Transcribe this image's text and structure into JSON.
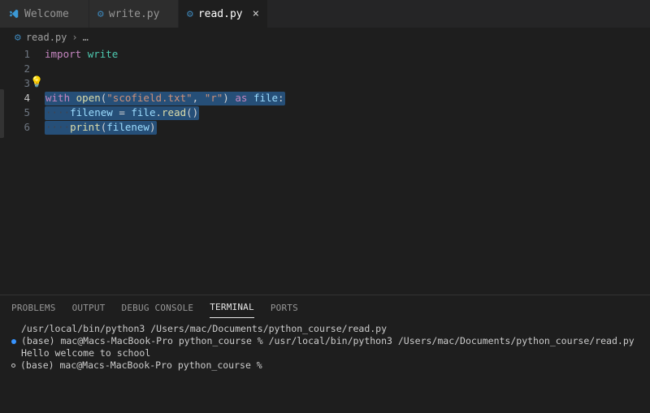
{
  "tabs": [
    {
      "label": "Welcome",
      "icon": "vscode",
      "active": false,
      "close": false
    },
    {
      "label": "write.py",
      "icon": "python",
      "active": false,
      "close": false
    },
    {
      "label": "read.py",
      "icon": "python",
      "active": true,
      "close": true
    }
  ],
  "breadcrumb": {
    "file_icon": "python",
    "file": "read.py",
    "chevron": "›",
    "tail": "…"
  },
  "editor": {
    "lightbulb": "💡",
    "lines": [
      {
        "n": "1",
        "sel": false,
        "tokens": [
          [
            "kw",
            "import"
          ],
          [
            "plain",
            " "
          ],
          [
            "mod",
            "write"
          ]
        ]
      },
      {
        "n": "2",
        "sel": false,
        "tokens": []
      },
      {
        "n": "3",
        "sel": false,
        "tokens": []
      },
      {
        "n": "4",
        "sel": true,
        "active": true,
        "tokens": [
          [
            "kw",
            "with"
          ],
          [
            "plain",
            " "
          ],
          [
            "fn",
            "open"
          ],
          [
            "plain",
            "("
          ],
          [
            "str",
            "\"scofield.txt\""
          ],
          [
            "plain",
            ", "
          ],
          [
            "str",
            "\"r\""
          ],
          [
            "plain",
            ") "
          ],
          [
            "kw",
            "as"
          ],
          [
            "plain",
            " "
          ],
          [
            "var",
            "file"
          ],
          [
            "plain",
            ":"
          ]
        ]
      },
      {
        "n": "5",
        "sel": true,
        "indent": "····",
        "tokens": [
          [
            "var",
            "filenew"
          ],
          [
            "plain",
            " = "
          ],
          [
            "var",
            "file"
          ],
          [
            "plain",
            "."
          ],
          [
            "fn",
            "read"
          ],
          [
            "plain",
            "()"
          ]
        ]
      },
      {
        "n": "6",
        "sel": true,
        "indent": "····",
        "tokens": [
          [
            "fn",
            "print"
          ],
          [
            "plain",
            "("
          ],
          [
            "var",
            "filenew"
          ],
          [
            "plain",
            ")"
          ]
        ]
      }
    ]
  },
  "panel_tabs": [
    {
      "label": "PROBLEMS",
      "active": false
    },
    {
      "label": "OUTPUT",
      "active": false
    },
    {
      "label": "DEBUG CONSOLE",
      "active": false
    },
    {
      "label": "TERMINAL",
      "active": true
    },
    {
      "label": "PORTS",
      "active": false
    }
  ],
  "terminal": {
    "lines": [
      {
        "dot": "",
        "text": "/usr/local/bin/python3 /Users/mac/Documents/python_course/read.py"
      },
      {
        "dot": "blue",
        "text": "(base) mac@Macs-MacBook-Pro python_course % /usr/local/bin/python3 /Users/mac/Documents/python_course/read.py"
      },
      {
        "dot": "",
        "text": "Hello welcome to school"
      },
      {
        "dot": "hollow",
        "text": "(base) mac@Macs-MacBook-Pro python_course % "
      }
    ]
  }
}
